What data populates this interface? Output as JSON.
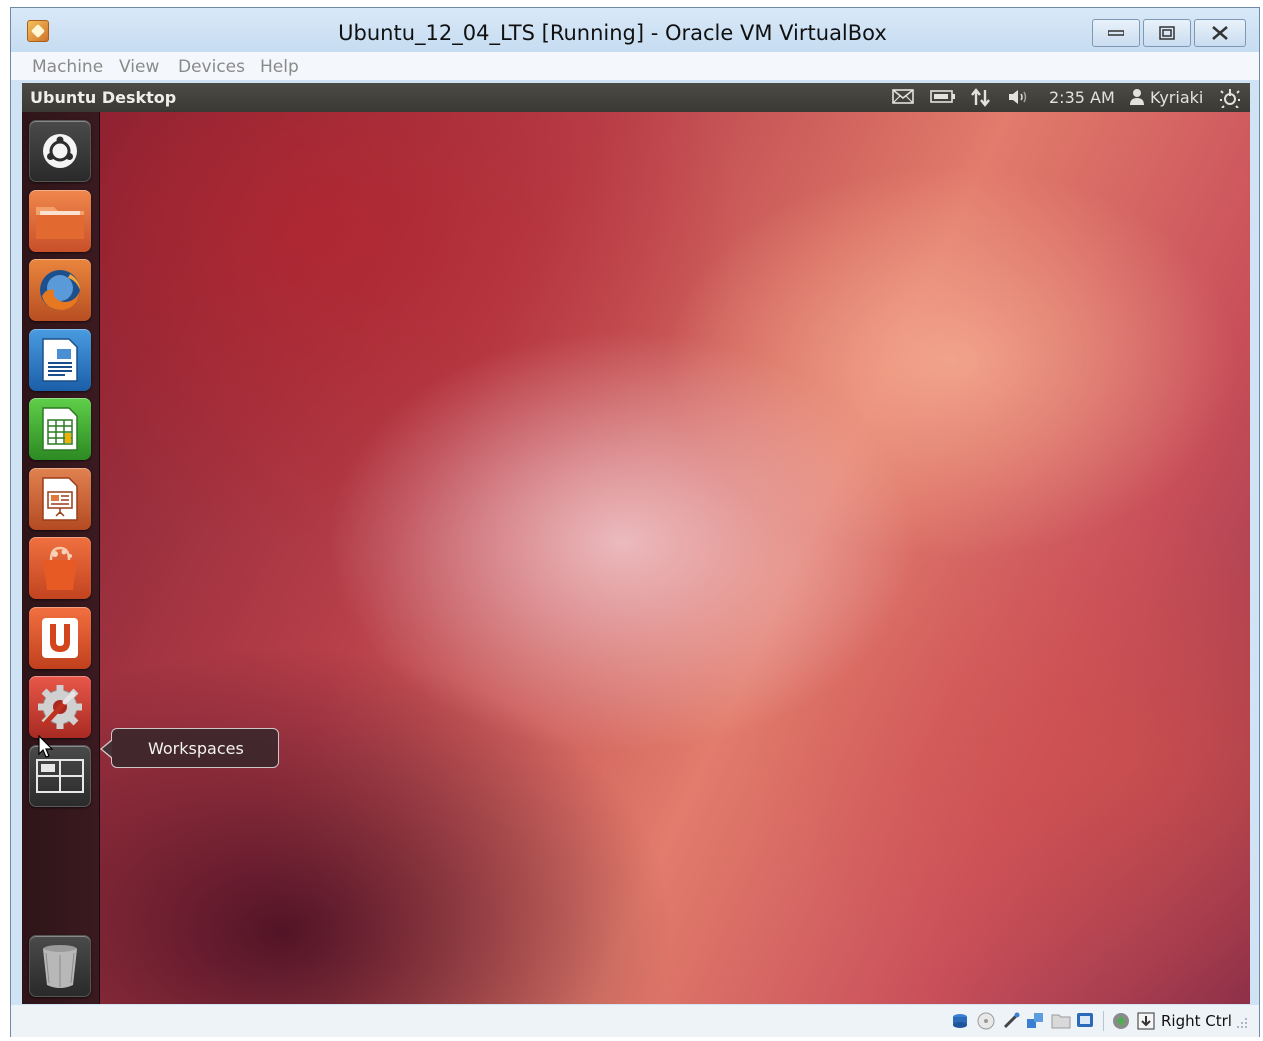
{
  "window": {
    "title": "Ubuntu_12_04_LTS [Running] - Oracle VM VirtualBox"
  },
  "menubar": {
    "items": [
      "Machine",
      "View",
      "Devices",
      "Help"
    ]
  },
  "guest_panel": {
    "title": "Ubuntu Desktop",
    "clock": "2:35 AM",
    "user": "Kyriaki"
  },
  "launcher": {
    "items": [
      {
        "name": "dash-home",
        "icon": "ubuntu-logo-icon"
      },
      {
        "name": "home-folder",
        "icon": "folder-icon"
      },
      {
        "name": "firefox",
        "icon": "firefox-icon"
      },
      {
        "name": "libreoffice-writer",
        "icon": "writer-icon"
      },
      {
        "name": "libreoffice-calc",
        "icon": "calc-icon"
      },
      {
        "name": "libreoffice-impress",
        "icon": "impress-icon"
      },
      {
        "name": "ubuntu-software-center",
        "icon": "shopping-bag-icon"
      },
      {
        "name": "ubuntu-one",
        "icon": "ubuntu-one-icon"
      },
      {
        "name": "system-settings",
        "icon": "settings-icon"
      },
      {
        "name": "workspaces",
        "icon": "workspaces-icon"
      },
      {
        "name": "trash",
        "icon": "trash-icon"
      }
    ],
    "tooltip": "Workspaces"
  },
  "statusbar": {
    "host_key": "Right Ctrl"
  },
  "colors": {
    "panel": "#3a3935",
    "launcher": "#2e1418",
    "wallpaper_accent": "#e27c6c"
  }
}
